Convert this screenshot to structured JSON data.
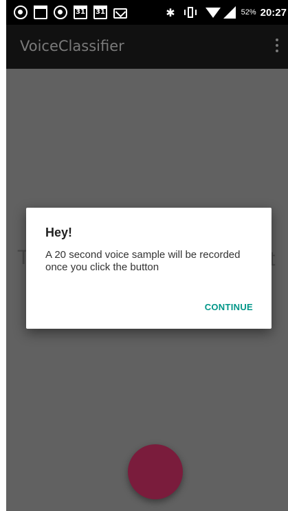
{
  "status_bar": {
    "icons": [
      "record-app-icon",
      "gallery-icon",
      "whatsapp-icon",
      "calendar-icon",
      "calendar-icon",
      "gmail-icon"
    ],
    "calendar_day": "31",
    "battery": "52%",
    "time": "20:27"
  },
  "app_bar": {
    "title": "VoiceClassifier"
  },
  "background": {
    "left_glyph": "T",
    "right_glyph": "t"
  },
  "dialog": {
    "title": "Hey!",
    "message": "A 20 second voice sample will be recorded once you click the button",
    "button": "CONTINUE"
  },
  "colors": {
    "accent": "#009688",
    "fab": "#7a1c3c",
    "scrim": "#616161"
  }
}
